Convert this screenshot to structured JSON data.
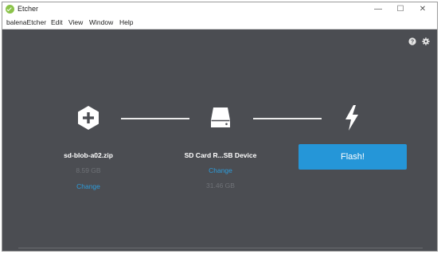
{
  "window": {
    "title": "Etcher",
    "controls": {
      "minimize": "—",
      "maximize": "☐",
      "close": "✕"
    }
  },
  "menu": {
    "items": [
      "balenaEtcher",
      "Edit",
      "View",
      "Window",
      "Help"
    ]
  },
  "header_icons": [
    "help-icon",
    "settings-icon"
  ],
  "steps": {
    "image": {
      "icon": "plus-hexagon-icon",
      "title": "sd-blob-a02.zip",
      "size": "8.59 GB",
      "change_label": "Change"
    },
    "drive": {
      "icon": "drive-icon",
      "title": "SD Card R...SB Device",
      "change_label": "Change",
      "size": "31.46 GB"
    },
    "flash": {
      "icon": "lightning-icon",
      "button_label": "Flash!"
    }
  },
  "colors": {
    "background": "#4b4d52",
    "accent": "#2596d8",
    "link": "#2d9cdb"
  }
}
